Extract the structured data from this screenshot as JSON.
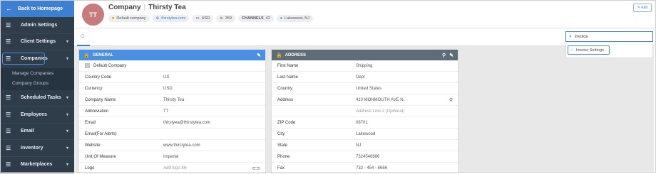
{
  "sidebar": {
    "back_label": "Back to Homepage",
    "items": [
      {
        "label": "Admin Settings"
      },
      {
        "label": "Client Settings"
      },
      {
        "label": "Companies"
      },
      {
        "label": "Scheduled Tasks"
      },
      {
        "label": "Employees"
      },
      {
        "label": "Email"
      },
      {
        "label": "Inventory"
      },
      {
        "label": "Marketplaces"
      }
    ],
    "sub_items": [
      "Manage Companies",
      "Company Groups"
    ]
  },
  "header": {
    "avatar_initials": "TT",
    "entity_type": "Company",
    "company_name": "Thirsty Tea",
    "chips": {
      "default": "Default company",
      "website": "thirstytea.com",
      "currency": "USD",
      "count": "359",
      "channels_label": "CHANNELS",
      "channels_count": "42",
      "location": "Lakewood, NJ"
    },
    "edit_label": "Edit"
  },
  "search": {
    "value": "invoice",
    "result": "Invoice Settings"
  },
  "general": {
    "title": "GENERAL",
    "default_company_label": "Default Company",
    "rows": [
      {
        "key": "Country Code",
        "value": "US"
      },
      {
        "key": "Currency",
        "value": "USD"
      },
      {
        "key": "Company Name",
        "value": "Thirsty Tea"
      },
      {
        "key": "Abbreviation",
        "value": "TT"
      },
      {
        "key": "Email",
        "value": "thirstyea@thirstytea.com"
      },
      {
        "key": "Email(For Alerts)",
        "value": ""
      },
      {
        "key": "Website",
        "value": "www.thirstytea.com"
      },
      {
        "key": "Unit Of Measure",
        "value": "Imperial"
      },
      {
        "key": "Logo",
        "value": "Add logo file"
      }
    ]
  },
  "address": {
    "title": "ADDRESS",
    "rows": [
      {
        "key": "First Name",
        "value": "Shipping"
      },
      {
        "key": "Last Name",
        "value": "Dept"
      },
      {
        "key": "Country",
        "value": "United States"
      },
      {
        "key": "Address",
        "value": "410 MONMOUTH AVE N."
      },
      {
        "key": "",
        "value": "Address Line 2 (Optional)"
      },
      {
        "key": "ZIP Code",
        "value": "08701"
      },
      {
        "key": "City",
        "value": "Lakewood"
      },
      {
        "key": "State",
        "value": "NJ"
      },
      {
        "key": "Phone",
        "value": "7324546666"
      },
      {
        "key": "Fax",
        "value": "732 - 454 - 6666"
      }
    ]
  },
  "colors": {
    "accent": "#4a90e2",
    "sidebar": "#2f3d4a",
    "address_header": "#5d6d77",
    "avatar": "#c77b7b"
  }
}
